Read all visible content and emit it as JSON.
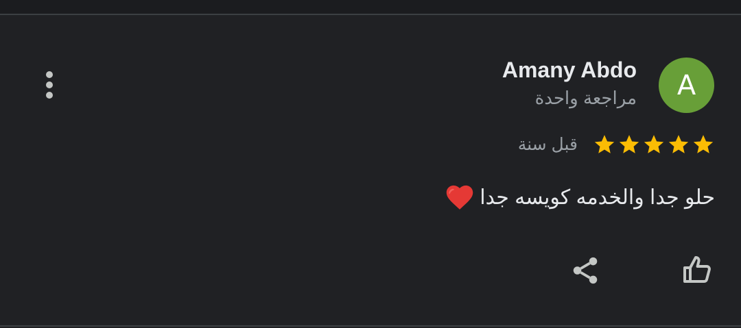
{
  "review": {
    "author_name": "Amany Abdo",
    "avatar_letter": "A",
    "review_count": "مراجعة واحدة",
    "rating": 5,
    "rating_max": 5,
    "date": "قبل سنة",
    "text": "حلو جدا والخدمه كويسه جدا"
  },
  "colors": {
    "background": "#202124",
    "avatar": "#689f38",
    "star": "#fbbc04",
    "heart": "#e53935",
    "secondary_text": "#9aa0a6"
  },
  "icons": {
    "more": "more-vert-icon",
    "star": "star-icon",
    "heart": "heart-emoji",
    "share": "share-icon",
    "like": "thumb-up-icon"
  }
}
